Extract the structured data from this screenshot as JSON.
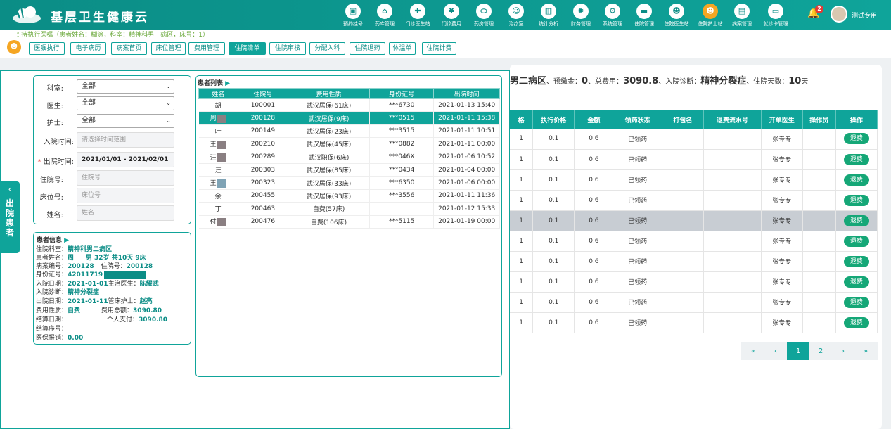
{
  "app": {
    "title": "基层卫生健康云",
    "user": "测试专用",
    "notification_count": "2"
  },
  "nav": [
    {
      "label": "预约挂号",
      "icon": "calendar-icon",
      "glyph": "▣"
    },
    {
      "label": "药库管理",
      "icon": "home-icon",
      "glyph": "⌂"
    },
    {
      "label": "门诊医生站",
      "icon": "doctor-icon",
      "glyph": "✚"
    },
    {
      "label": "门诊费用",
      "icon": "yuan-icon",
      "glyph": "¥"
    },
    {
      "label": "药房管理",
      "icon": "pill-icon",
      "glyph": "⬭"
    },
    {
      "label": "治疗室",
      "icon": "nurse-icon",
      "glyph": "☺"
    },
    {
      "label": "统计分析",
      "icon": "bar-chart-icon",
      "glyph": "▥"
    },
    {
      "label": "财务管理",
      "icon": "gear-icon",
      "glyph": "✹"
    },
    {
      "label": "系统管理",
      "icon": "settings-icon",
      "glyph": "⚙"
    },
    {
      "label": "住院管理",
      "icon": "bed-icon",
      "glyph": "▬"
    },
    {
      "label": "住院医生站",
      "icon": "doctor-group-icon",
      "glyph": "☻"
    },
    {
      "label": "住院护士站",
      "icon": "nurse-station-icon",
      "glyph": "☻"
    },
    {
      "label": "病案管理",
      "icon": "document-icon",
      "glyph": "▤"
    },
    {
      "label": "就诊卡管理",
      "icon": "card-icon",
      "glyph": "▭"
    }
  ],
  "pending_text": "待执行医嘱（患者姓名：糊涂，科室：精神科男一病区，床号：1）",
  "subtabs": [
    "医嘱执行",
    "电子病历",
    "病案首页",
    "床位管理",
    "费用管理",
    "住院清单",
    "住院审核",
    "分配入科",
    "住院退药",
    "体温单",
    "住院计费"
  ],
  "drawer": {
    "tab_label": "出院患者",
    "tab_arrow": "‹"
  },
  "filters": {
    "dept_label": "科室:",
    "dept_value": "全部",
    "doctor_label": "医生:",
    "doctor_value": "全部",
    "nurse_label": "护士:",
    "nurse_value": "全部",
    "admit_label": "入院时间:",
    "admit_placeholder": "请选择时间范围",
    "discharge_label": "出院时间:",
    "discharge_value": "2021/01/01 - 2021/02/01",
    "inpatient_label": "住院号:",
    "inpatient_placeholder": "住院号",
    "bed_label": "床位号:",
    "bed_placeholder": "床位号",
    "name_label": "姓名:",
    "name_placeholder": "姓名"
  },
  "patient_info": {
    "title": "患者信息",
    "dept": "住院科室：",
    "dept_v": "精神科男二病区",
    "name": "患者姓名：",
    "name_v": "周",
    "name_extra": "男 32岁 共10天 9床",
    "record": "病案编号：",
    "record_v": "200128",
    "inp": "住院号：",
    "inp_v": "200128",
    "idno": "身份证号：",
    "idno_v": "42011719",
    "admit": "入院日期：",
    "admit_v": "2021-01-01",
    "doctor": "主治医生：",
    "doctor_v": "陈耀武",
    "diag": "入院诊断：",
    "diag_v": "精神分裂症",
    "discharge": "出院日期：",
    "discharge_v": "2021-01-11",
    "nurse": "管床护士：",
    "nurse_v": "赵亮",
    "fee": "费用性质：",
    "fee_v": "自费",
    "total": "费用总额：",
    "total_v": "3090.80",
    "settle": "结算日期：",
    "self": "个人支付：",
    "self_v": "3090.80",
    "settle_no": "结算序号：",
    "insurance": "医保报销：",
    "insurance_v": "0.00"
  },
  "patient_list": {
    "title": "患者列表",
    "headers": [
      "姓名",
      "住院号",
      "费用性质",
      "身份证号",
      "出院时间"
    ],
    "rows": [
      {
        "name": "胡",
        "id": "100001",
        "fee": "武汉居保(61床)",
        "idno": "***6730",
        "time": "2021-01-13 15:40"
      },
      {
        "name": "周",
        "id": "200128",
        "fee": "武汉居保(9床)",
        "idno": "***0515",
        "time": "2021-01-11 15:38"
      },
      {
        "name": "叶",
        "id": "200149",
        "fee": "武汉居保(23床)",
        "idno": "***3515",
        "time": "2021-01-11 10:51"
      },
      {
        "name": "王",
        "id": "200210",
        "fee": "武汉居保(45床)",
        "idno": "***0882",
        "time": "2021-01-11 00:00"
      },
      {
        "name": "汪",
        "id": "200289",
        "fee": "武汉职保(6床)",
        "idno": "***046X",
        "time": "2021-01-06 10:52"
      },
      {
        "name": "汪",
        "id": "200303",
        "fee": "武汉居保(85床)",
        "idno": "***0434",
        "time": "2021-01-04 00:00"
      },
      {
        "name": "王",
        "id": "200323",
        "fee": "武汉居保(33床)",
        "idno": "***6350",
        "time": "2021-01-06 00:00"
      },
      {
        "name": "余",
        "id": "200455",
        "fee": "武汉居保(93床)",
        "idno": "***3556",
        "time": "2021-01-11 11:36"
      },
      {
        "name": "丁",
        "id": "200463",
        "fee": "自费(57床)",
        "idno": "",
        "time": "2021-01-12 15:33"
      },
      {
        "name": "付",
        "id": "200476",
        "fee": "自费(106床)",
        "idno": "***5115",
        "time": "2021-01-19 00:00"
      }
    ]
  },
  "summary": {
    "ward": "男二病区",
    "t1": "、预缴金：",
    "deposit": "0",
    "t2": "、总费用：",
    "total": "3090.8",
    "t3": "、入院诊断：",
    "diag": "精神分裂症",
    "t4": "、住院天数：",
    "days": "10",
    "t5": "天"
  },
  "orders": {
    "headers": [
      "格",
      "执行价格",
      "金额",
      "领药状态",
      "打包名",
      "退费流水号",
      "开单医生",
      "操作员",
      "操作"
    ],
    "rows": [
      {
        "c0": "1",
        "price": "0.1",
        "amount": "0.6",
        "status": "已领药",
        "doctor": "张专专",
        "action": "退费"
      },
      {
        "c0": "1",
        "price": "0.1",
        "amount": "0.6",
        "status": "已领药",
        "doctor": "张专专",
        "action": "退费"
      },
      {
        "c0": "1",
        "price": "0.1",
        "amount": "0.6",
        "status": "已领药",
        "doctor": "张专专",
        "action": "退费"
      },
      {
        "c0": "1",
        "price": "0.1",
        "amount": "0.6",
        "status": "已领药",
        "doctor": "张专专",
        "action": "退费"
      },
      {
        "c0": "1",
        "price": "0.1",
        "amount": "0.6",
        "status": "已领药",
        "doctor": "张专专",
        "action": "退费"
      },
      {
        "c0": "1",
        "price": "0.1",
        "amount": "0.6",
        "status": "已领药",
        "doctor": "张专专",
        "action": "退费"
      },
      {
        "c0": "1",
        "price": "0.1",
        "amount": "0.6",
        "status": "已领药",
        "doctor": "张专专",
        "action": "退费"
      },
      {
        "c0": "1",
        "price": "0.1",
        "amount": "0.6",
        "status": "已领药",
        "doctor": "张专专",
        "action": "退费"
      },
      {
        "c0": "1",
        "price": "0.1",
        "amount": "0.6",
        "status": "已领药",
        "doctor": "张专专",
        "action": "退费"
      },
      {
        "c0": "1",
        "price": "0.1",
        "amount": "0.6",
        "status": "已领药",
        "doctor": "张专专",
        "action": "退费"
      }
    ]
  },
  "pager": {
    "first": "«",
    "prev": "‹",
    "p1": "1",
    "p2": "2",
    "next": "›",
    "last": "»"
  },
  "colors": {
    "primary": "#0fa49a",
    "refund": "#15a777",
    "badge": "#e53935"
  }
}
